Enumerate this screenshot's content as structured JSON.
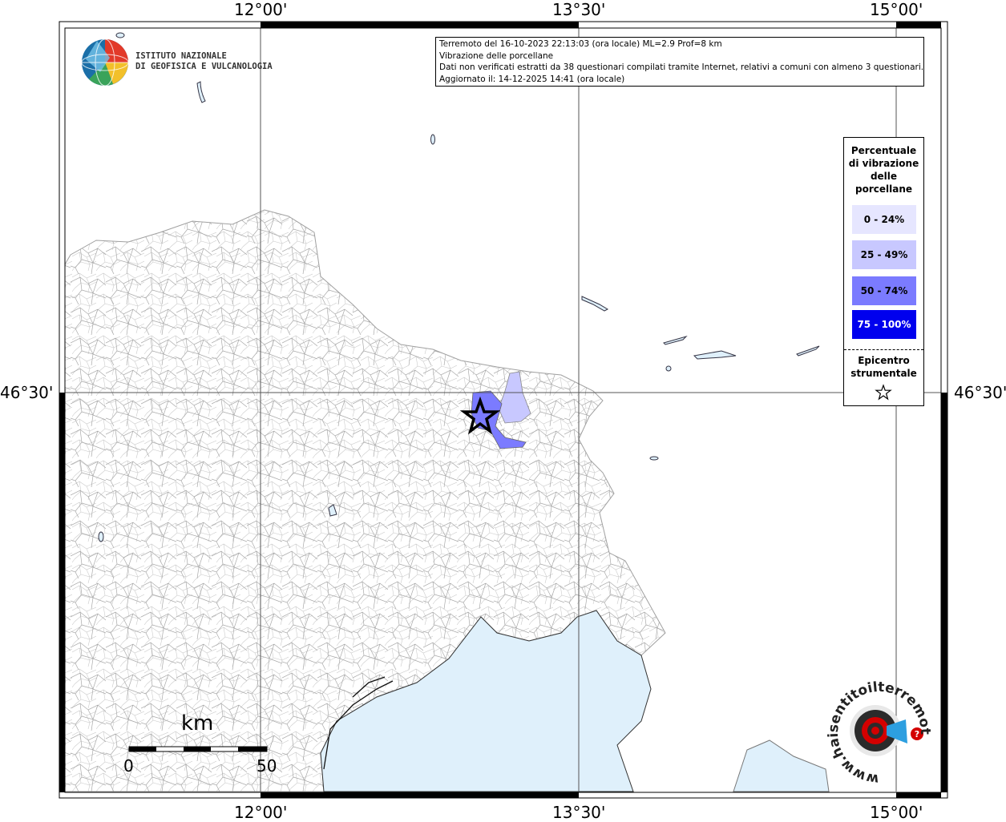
{
  "header": {
    "line1": "Terremoto del 16-10-2023 22:13:03 (ora locale) ML=2.9 Prof=8 km",
    "line2": "Vibrazione delle porcellane",
    "line3": "Dati non verificati estratti da 38 questionari compilati tramite Internet, relativi a comuni con almeno 3 questionari.",
    "line4": "Aggiornato il: 14-12-2025 14:41 (ora locale)"
  },
  "logo": {
    "line1": "ISTITUTO NAZIONALE",
    "line2": "DI GEOFISICA E VULCANOLOGIA",
    "icon": "ingv-globe-icon"
  },
  "axes": {
    "top": [
      "12°00'",
      "13°30'",
      "15°00'"
    ],
    "bottom": [
      "12°00'",
      "13°30'",
      "15°00'"
    ],
    "left": "46°30'",
    "right": "46°30'"
  },
  "legend": {
    "title_lines": [
      "Percentuale",
      "di vibrazione",
      "delle",
      "porcellane"
    ],
    "classes": [
      {
        "label": "0 - 24%",
        "color": "#e6e6ff",
        "text_color": "#000000"
      },
      {
        "label": "25 - 49%",
        "color": "#c8c8ff",
        "text_color": "#000000"
      },
      {
        "label": "50 - 74%",
        "color": "#7b7bff",
        "text_color": "#000000"
      },
      {
        "label": "75 - 100%",
        "color": "#0000ee",
        "text_color": "#ffffff"
      }
    ],
    "epicenter_title": [
      "Epicentro",
      "strumentale"
    ],
    "epicenter_icon": "star-icon"
  },
  "scalebar": {
    "unit": "km",
    "start": "0",
    "end": "50"
  },
  "brand": {
    "text": "www.haisentitoilterremoto.it",
    "icon": "target-icon",
    "accent": "#d40000"
  },
  "colors": {
    "sea": "#dff0fb",
    "borders": "#9a9a9a",
    "grid": "#555555"
  }
}
